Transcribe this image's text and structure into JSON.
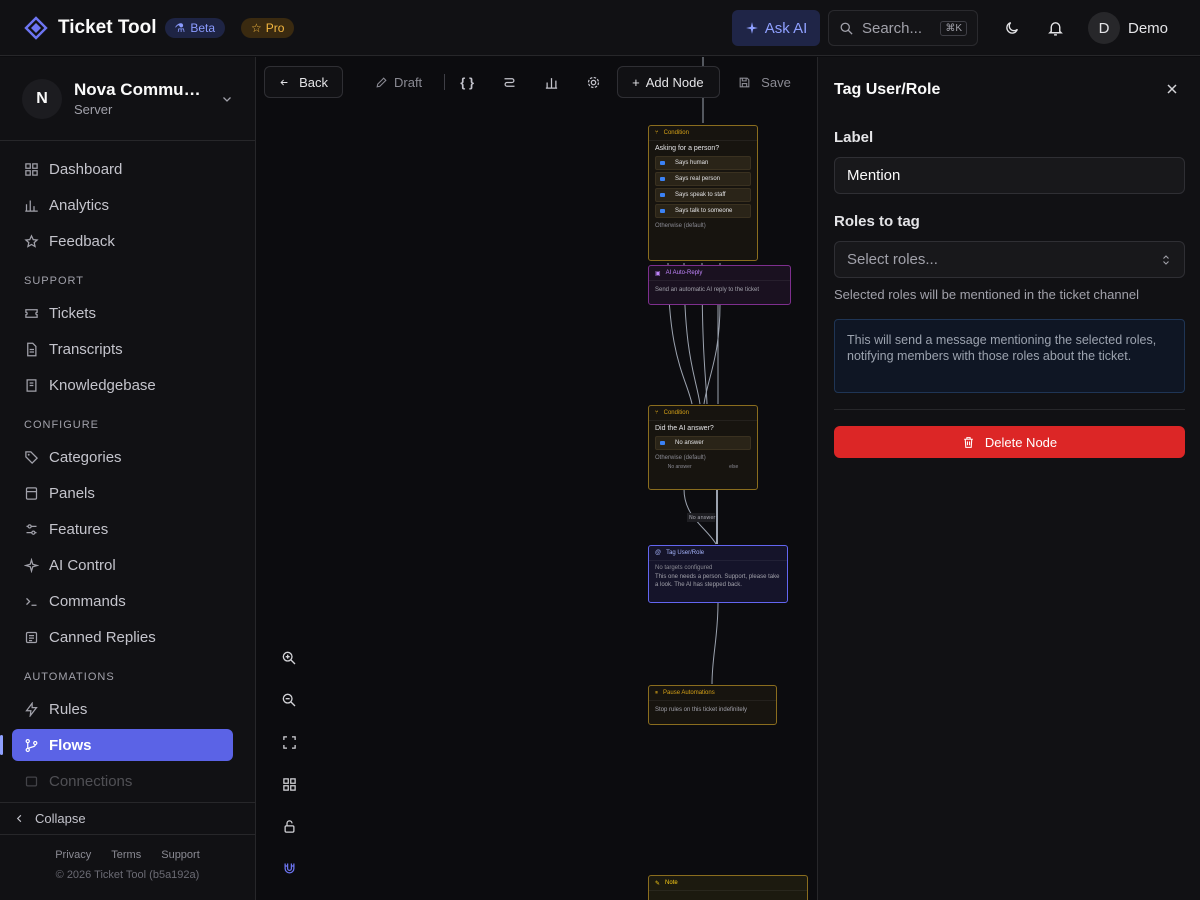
{
  "app": {
    "name": "Ticket Tool",
    "beta_label": "Beta",
    "pro_label": "Pro"
  },
  "topbar": {
    "ask_ai": "Ask AI",
    "search_placeholder": "Search...",
    "search_shortcut": "⌘K",
    "user_initial": "D",
    "user_name": "Demo"
  },
  "server": {
    "initial": "N",
    "name": "Nova Community",
    "type": "Server"
  },
  "nav": {
    "main": [
      {
        "label": "Dashboard",
        "icon": "dashboard-icon"
      },
      {
        "label": "Analytics",
        "icon": "bar-chart-icon"
      },
      {
        "label": "Feedback",
        "icon": "star-icon"
      }
    ],
    "support_title": "SUPPORT",
    "support": [
      {
        "label": "Tickets",
        "icon": "ticket-icon"
      },
      {
        "label": "Transcripts",
        "icon": "file-text-icon"
      },
      {
        "label": "Knowledgebase",
        "icon": "book-icon"
      }
    ],
    "configure_title": "CONFIGURE",
    "configure": [
      {
        "label": "Categories",
        "icon": "tag-icon"
      },
      {
        "label": "Panels",
        "icon": "panel-icon"
      },
      {
        "label": "Features",
        "icon": "sliders-icon"
      },
      {
        "label": "AI Control",
        "icon": "sparkle-icon"
      },
      {
        "label": "Commands",
        "icon": "terminal-icon"
      },
      {
        "label": "Canned Replies",
        "icon": "list-icon"
      }
    ],
    "automations_title": "AUTOMATIONS",
    "automations": [
      {
        "label": "Rules",
        "icon": "bolt-icon"
      },
      {
        "label": "Flows",
        "icon": "flow-icon",
        "active": true
      },
      {
        "label": "Connections",
        "icon": "plug-icon"
      }
    ],
    "collapse": "Collapse",
    "footer": {
      "privacy": "Privacy",
      "terms": "Terms",
      "support": "Support",
      "copyright": "© 2026 Ticket Tool (b5a192a)"
    }
  },
  "toolbar": {
    "back": "Back",
    "draft": "Draft",
    "add_node": "Add Node",
    "save": "Save"
  },
  "flow": {
    "condition1": {
      "type": "Condition",
      "title": "Asking for a person?",
      "rows": [
        "Says human",
        "Says real person",
        "Says speak to staff",
        "Says talk to someone"
      ],
      "otherwise": "Otherwise (default)"
    },
    "ai_reply": {
      "type": "AI Auto-Reply",
      "body": "Send an automatic AI reply to the ticket"
    },
    "condition2": {
      "type": "Condition",
      "title": "Did the AI answer?",
      "rows": [
        "No answer"
      ],
      "otherwise": "Otherwise (default)",
      "out1": "No answer",
      "out2": "else"
    },
    "edge_label": "No answer",
    "tag_node": {
      "type": "Tag User/Role",
      "sub": "No targets configured",
      "body": "This one needs a person. Support, please take a look. The AI has stepped back."
    },
    "pause_node": {
      "type": "Pause Automations",
      "body": "Stop rules on this ticket indefinitely"
    },
    "note_node": {
      "type": "Note"
    }
  },
  "panel": {
    "title": "Tag User/Role",
    "label_title": "Label",
    "label_value": "Mention",
    "roles_title": "Roles to tag",
    "roles_placeholder": "Select roles...",
    "hint": "Selected roles will be mentioned in the ticket channel",
    "info": "This will send a message mentioning the selected roles, notifying members with those roles about the ticket.",
    "delete": "Delete Node"
  },
  "colors": {
    "accent": "#5b63e6",
    "danger": "#dc2626",
    "condition": "#b8860b",
    "ai": "#a855f7",
    "tag": "#6366f1",
    "pause": "#b8860b"
  }
}
